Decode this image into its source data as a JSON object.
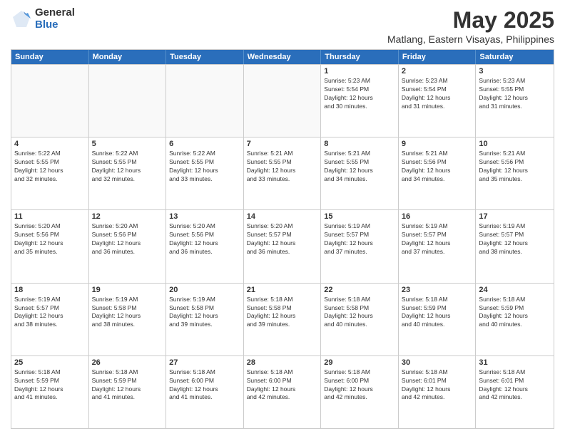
{
  "logo": {
    "general": "General",
    "blue": "Blue"
  },
  "title": "May 2025",
  "subtitle": "Matlang, Eastern Visayas, Philippines",
  "header": {
    "days": [
      "Sunday",
      "Monday",
      "Tuesday",
      "Wednesday",
      "Thursday",
      "Friday",
      "Saturday"
    ]
  },
  "weeks": [
    [
      {
        "day": "",
        "info": ""
      },
      {
        "day": "",
        "info": ""
      },
      {
        "day": "",
        "info": ""
      },
      {
        "day": "",
        "info": ""
      },
      {
        "day": "1",
        "info": "Sunrise: 5:23 AM\nSunset: 5:54 PM\nDaylight: 12 hours\nand 30 minutes."
      },
      {
        "day": "2",
        "info": "Sunrise: 5:23 AM\nSunset: 5:54 PM\nDaylight: 12 hours\nand 31 minutes."
      },
      {
        "day": "3",
        "info": "Sunrise: 5:23 AM\nSunset: 5:55 PM\nDaylight: 12 hours\nand 31 minutes."
      }
    ],
    [
      {
        "day": "4",
        "info": "Sunrise: 5:22 AM\nSunset: 5:55 PM\nDaylight: 12 hours\nand 32 minutes."
      },
      {
        "day": "5",
        "info": "Sunrise: 5:22 AM\nSunset: 5:55 PM\nDaylight: 12 hours\nand 32 minutes."
      },
      {
        "day": "6",
        "info": "Sunrise: 5:22 AM\nSunset: 5:55 PM\nDaylight: 12 hours\nand 33 minutes."
      },
      {
        "day": "7",
        "info": "Sunrise: 5:21 AM\nSunset: 5:55 PM\nDaylight: 12 hours\nand 33 minutes."
      },
      {
        "day": "8",
        "info": "Sunrise: 5:21 AM\nSunset: 5:55 PM\nDaylight: 12 hours\nand 34 minutes."
      },
      {
        "day": "9",
        "info": "Sunrise: 5:21 AM\nSunset: 5:56 PM\nDaylight: 12 hours\nand 34 minutes."
      },
      {
        "day": "10",
        "info": "Sunrise: 5:21 AM\nSunset: 5:56 PM\nDaylight: 12 hours\nand 35 minutes."
      }
    ],
    [
      {
        "day": "11",
        "info": "Sunrise: 5:20 AM\nSunset: 5:56 PM\nDaylight: 12 hours\nand 35 minutes."
      },
      {
        "day": "12",
        "info": "Sunrise: 5:20 AM\nSunset: 5:56 PM\nDaylight: 12 hours\nand 36 minutes."
      },
      {
        "day": "13",
        "info": "Sunrise: 5:20 AM\nSunset: 5:56 PM\nDaylight: 12 hours\nand 36 minutes."
      },
      {
        "day": "14",
        "info": "Sunrise: 5:20 AM\nSunset: 5:57 PM\nDaylight: 12 hours\nand 36 minutes."
      },
      {
        "day": "15",
        "info": "Sunrise: 5:19 AM\nSunset: 5:57 PM\nDaylight: 12 hours\nand 37 minutes."
      },
      {
        "day": "16",
        "info": "Sunrise: 5:19 AM\nSunset: 5:57 PM\nDaylight: 12 hours\nand 37 minutes."
      },
      {
        "day": "17",
        "info": "Sunrise: 5:19 AM\nSunset: 5:57 PM\nDaylight: 12 hours\nand 38 minutes."
      }
    ],
    [
      {
        "day": "18",
        "info": "Sunrise: 5:19 AM\nSunset: 5:57 PM\nDaylight: 12 hours\nand 38 minutes."
      },
      {
        "day": "19",
        "info": "Sunrise: 5:19 AM\nSunset: 5:58 PM\nDaylight: 12 hours\nand 38 minutes."
      },
      {
        "day": "20",
        "info": "Sunrise: 5:19 AM\nSunset: 5:58 PM\nDaylight: 12 hours\nand 39 minutes."
      },
      {
        "day": "21",
        "info": "Sunrise: 5:18 AM\nSunset: 5:58 PM\nDaylight: 12 hours\nand 39 minutes."
      },
      {
        "day": "22",
        "info": "Sunrise: 5:18 AM\nSunset: 5:58 PM\nDaylight: 12 hours\nand 40 minutes."
      },
      {
        "day": "23",
        "info": "Sunrise: 5:18 AM\nSunset: 5:59 PM\nDaylight: 12 hours\nand 40 minutes."
      },
      {
        "day": "24",
        "info": "Sunrise: 5:18 AM\nSunset: 5:59 PM\nDaylight: 12 hours\nand 40 minutes."
      }
    ],
    [
      {
        "day": "25",
        "info": "Sunrise: 5:18 AM\nSunset: 5:59 PM\nDaylight: 12 hours\nand 41 minutes."
      },
      {
        "day": "26",
        "info": "Sunrise: 5:18 AM\nSunset: 5:59 PM\nDaylight: 12 hours\nand 41 minutes."
      },
      {
        "day": "27",
        "info": "Sunrise: 5:18 AM\nSunset: 6:00 PM\nDaylight: 12 hours\nand 41 minutes."
      },
      {
        "day": "28",
        "info": "Sunrise: 5:18 AM\nSunset: 6:00 PM\nDaylight: 12 hours\nand 42 minutes."
      },
      {
        "day": "29",
        "info": "Sunrise: 5:18 AM\nSunset: 6:00 PM\nDaylight: 12 hours\nand 42 minutes."
      },
      {
        "day": "30",
        "info": "Sunrise: 5:18 AM\nSunset: 6:01 PM\nDaylight: 12 hours\nand 42 minutes."
      },
      {
        "day": "31",
        "info": "Sunrise: 5:18 AM\nSunset: 6:01 PM\nDaylight: 12 hours\nand 42 minutes."
      }
    ]
  ]
}
